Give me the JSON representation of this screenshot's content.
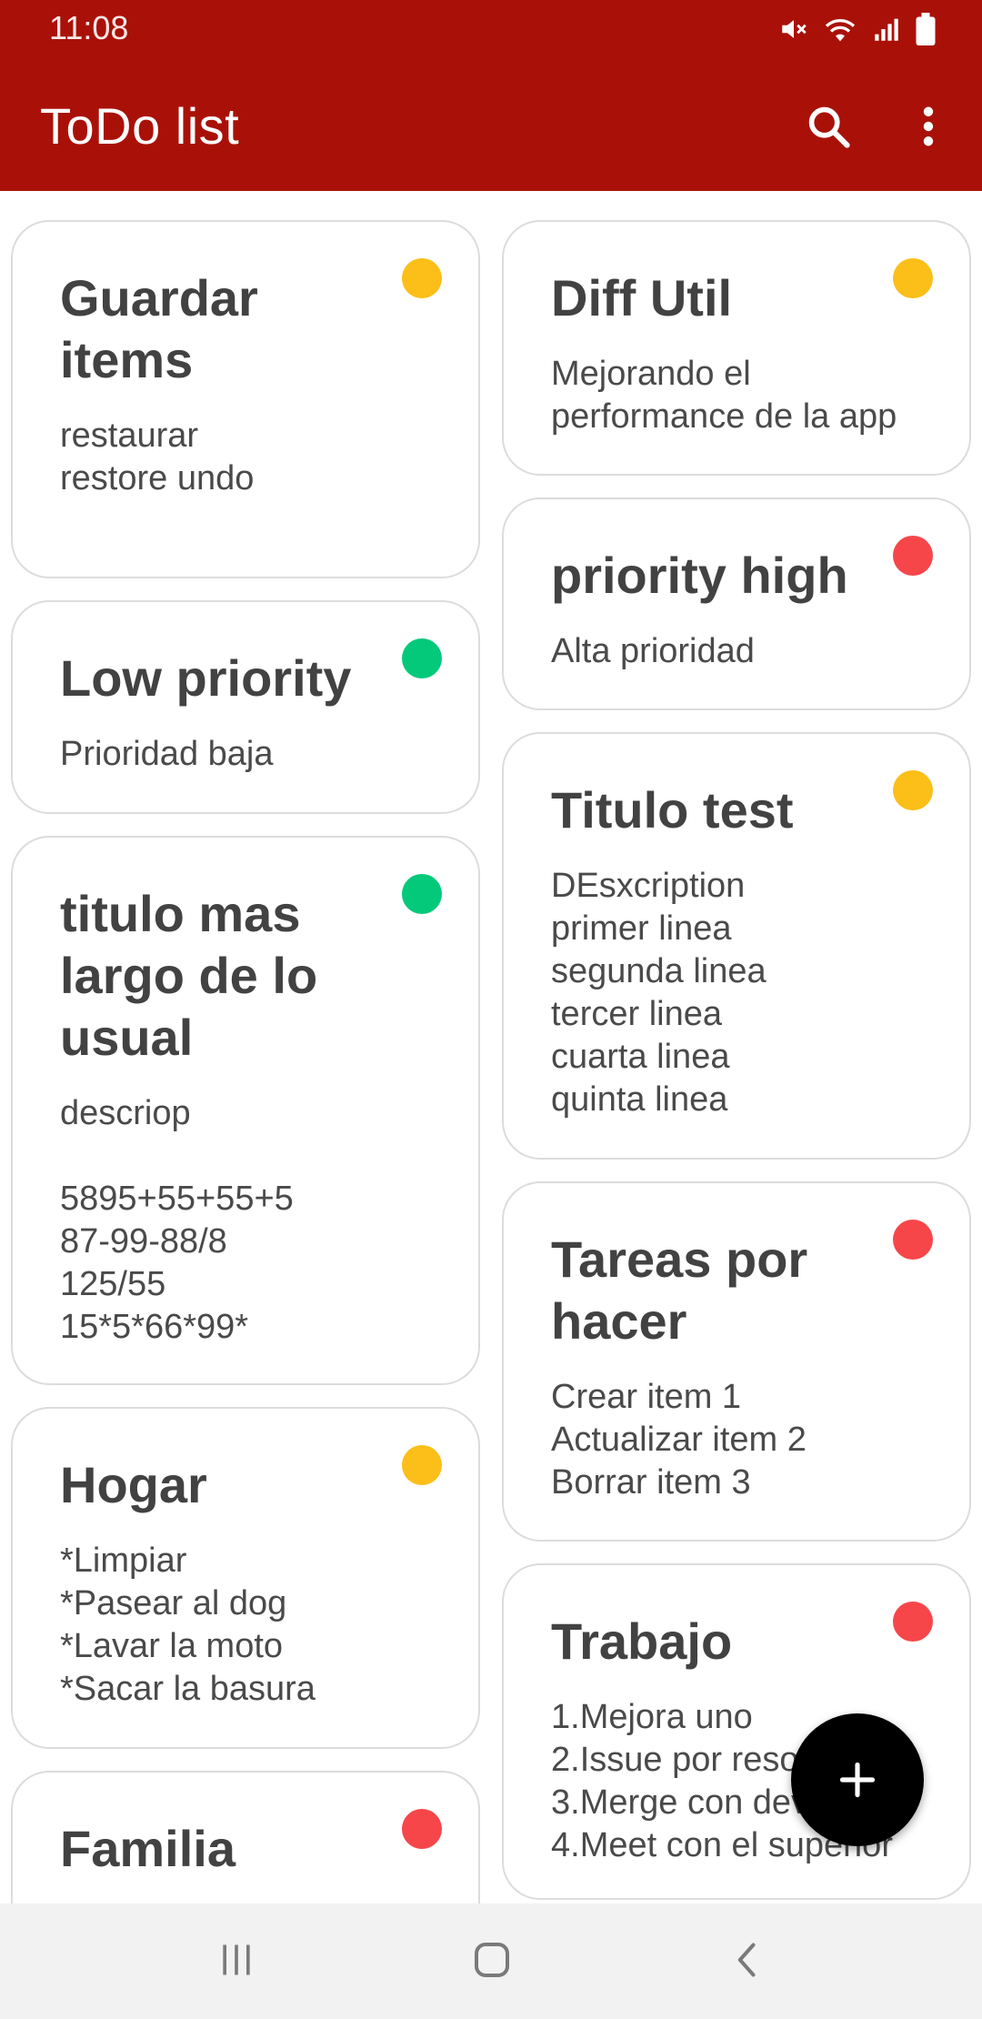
{
  "status_bar": {
    "time": "11:08",
    "icons": [
      "mute-icon",
      "wifi-icon",
      "signal-icon",
      "battery-icon"
    ]
  },
  "app_bar": {
    "title": "ToDo list",
    "actions": [
      "search-icon",
      "more-vert-icon"
    ],
    "color": "#a91108"
  },
  "priority_colors": {
    "low": "#04c97b",
    "medium": "#fcbe18",
    "high": "#f6464a"
  },
  "notes_left": [
    {
      "title": "Guardar items",
      "description": "restaurar\nrestore undo",
      "priority": "medium"
    },
    {
      "title": "Low priority",
      "description": "Prioridad baja",
      "priority": "low"
    },
    {
      "title": "titulo mas largo de lo usual",
      "description": "descriop\n\n5895+55+55+5\n87-99-88/8\n125/55\n15*5*66*99*",
      "priority": "low"
    },
    {
      "title": "Hogar",
      "description": "*Limpiar\n*Pasear al dog\n*Lavar la moto\n*Sacar la basura",
      "priority": "medium"
    },
    {
      "title": "Familia",
      "description": "",
      "priority": "high"
    }
  ],
  "notes_right": [
    {
      "title": "Diff Util",
      "description": "Mejorando el\nperformance de la app",
      "priority": "medium"
    },
    {
      "title": "priority high",
      "description": "Alta prioridad",
      "priority": "high"
    },
    {
      "title": "Titulo test",
      "description": "DEsxcription\nprimer linea\nsegunda linea\ntercer linea\ncuarta linea\nquinta linea",
      "priority": "medium"
    },
    {
      "title": "Tareas por hacer",
      "description": "Crear item 1\nActualizar item 2\nBorrar item 3",
      "priority": "high"
    },
    {
      "title": "Trabajo",
      "description": "1.Mejora uno\n2.Issue por resolver\n3.Merge con develop\n4.Meet con el superior",
      "priority": "high"
    }
  ],
  "fab": {
    "icon": "add-icon"
  },
  "nav_bar": {
    "buttons": [
      "recents-icon",
      "home-icon",
      "back-icon"
    ]
  }
}
